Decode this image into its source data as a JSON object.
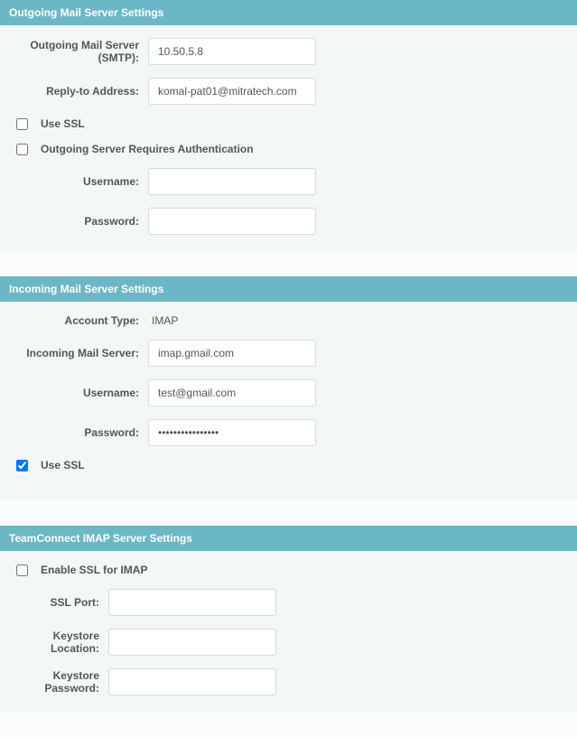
{
  "outgoing": {
    "header": "Outgoing Mail Server Settings",
    "smtp_label": "Outgoing Mail Server (SMTP):",
    "smtp_value": "10.50.5.8",
    "reply_label": "Reply-to Address:",
    "reply_value": "komal-pat01@mitratech.com",
    "use_ssl_label": "Use SSL",
    "use_ssl_checked": false,
    "auth_label": "Outgoing Server Requires Authentication",
    "auth_checked": false,
    "username_label": "Username:",
    "username_value": "",
    "password_label": "Password:",
    "password_value": ""
  },
  "incoming": {
    "header": "Incoming Mail Server Settings",
    "account_type_label": "Account Type:",
    "account_type_value": "IMAP",
    "server_label": "Incoming Mail Server:",
    "server_value": "imap.gmail.com",
    "username_label": "Username:",
    "username_value": "test@gmail.com",
    "password_label": "Password:",
    "password_value": "••••••••••••••••",
    "use_ssl_label": "Use SSL",
    "use_ssl_checked": true
  },
  "imap": {
    "header": "TeamConnect IMAP Server Settings",
    "enable_ssl_label": "Enable SSL for IMAP",
    "enable_ssl_checked": false,
    "ssl_port_label": "SSL Port:",
    "ssl_port_value": "",
    "keystore_loc_label": "Keystore Location:",
    "keystore_loc_value": "",
    "keystore_pw_label": "Keystore Password:",
    "keystore_pw_value": ""
  }
}
